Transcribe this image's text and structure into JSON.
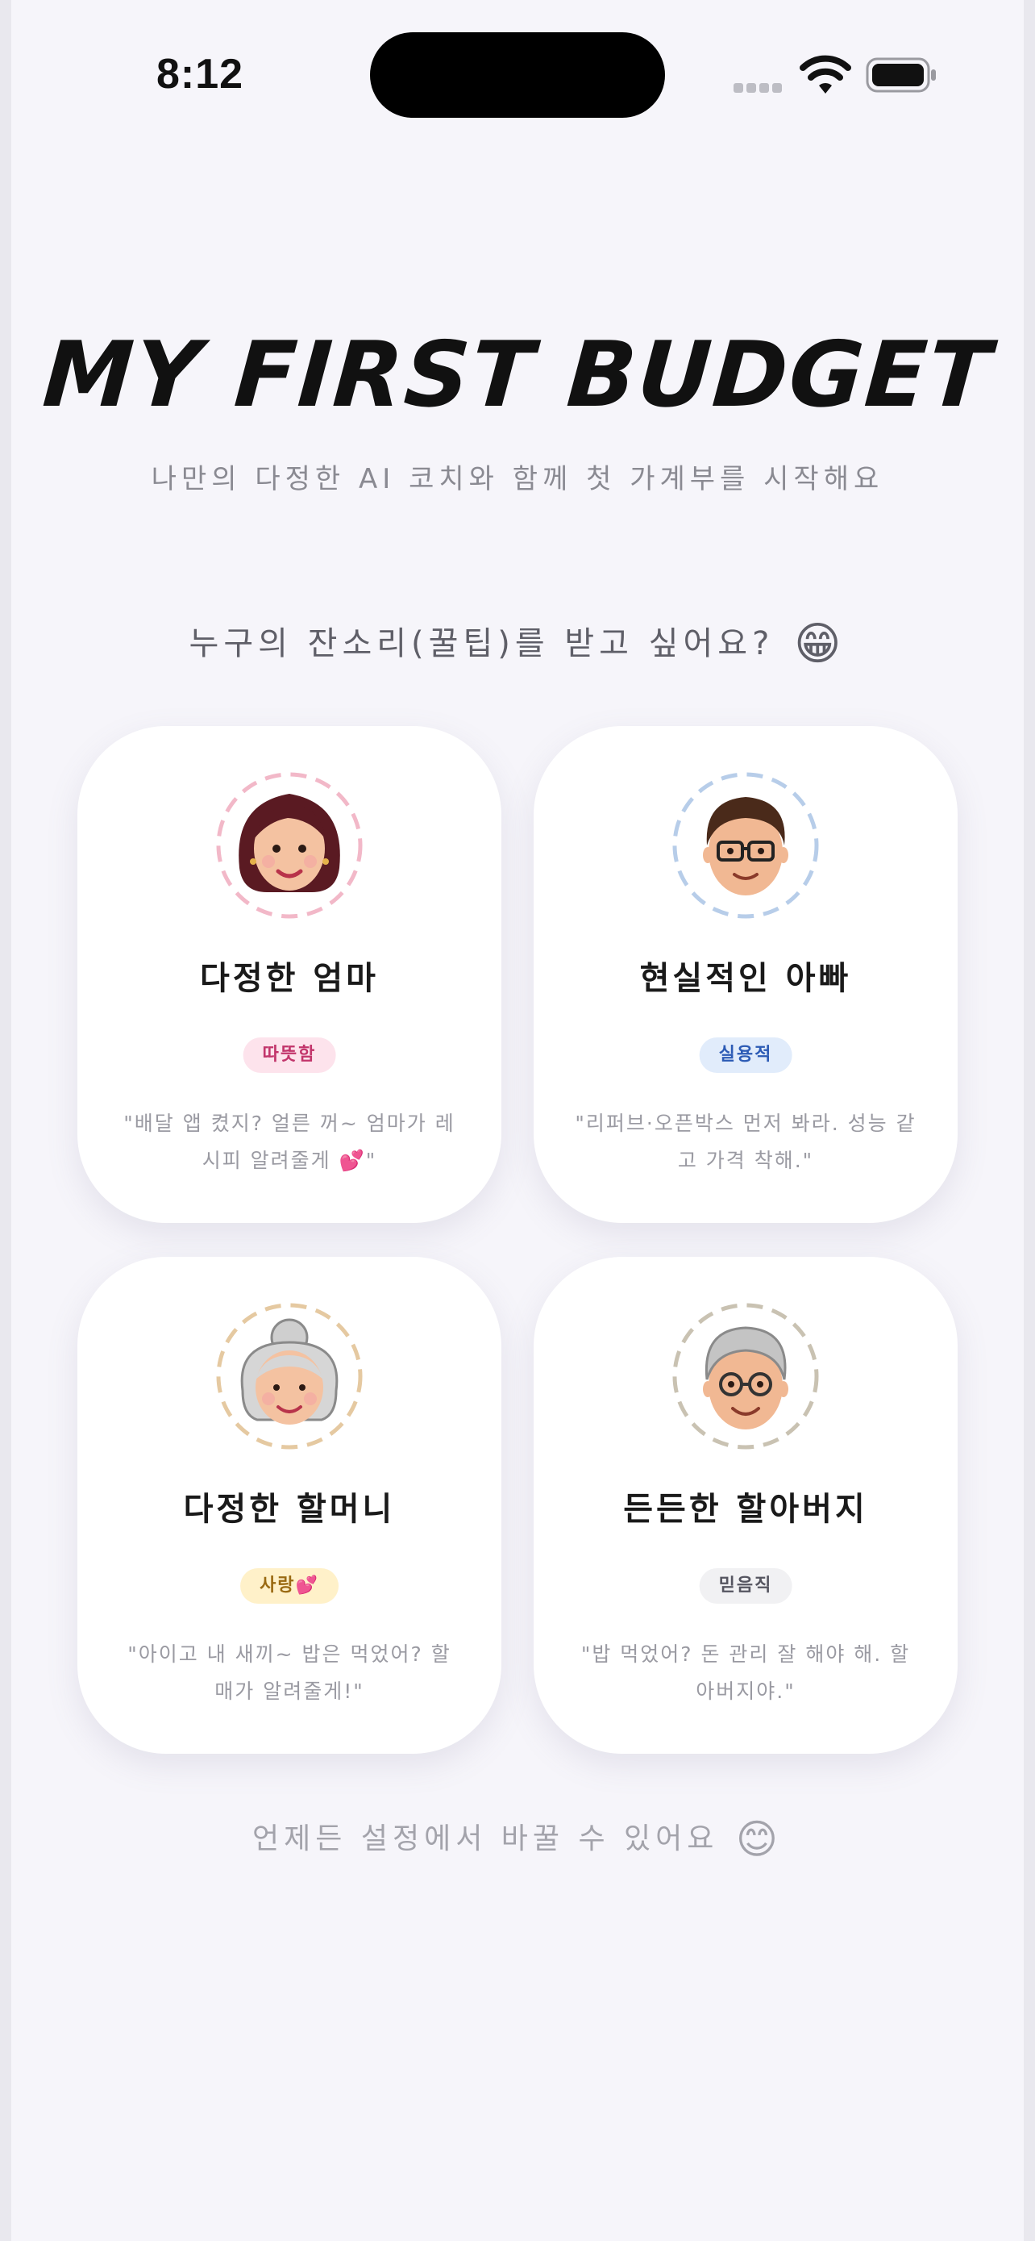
{
  "status_bar": {
    "time": "8:12"
  },
  "header": {
    "title": "MY FIRST BUDGET",
    "subtitle": "나만의 다정한 AI 코치와 함께 첫 가계부를 시작해요"
  },
  "question": {
    "text": "누구의 잔소리(꿀팁)를 받고 싶어요?",
    "emoji": "😁"
  },
  "cards": [
    {
      "name": "다정한 엄마",
      "tag": "따뜻함",
      "quote": "\"배달 앱 켰지? 얼른 꺼~ 엄마가 레시피 알려줄게 💕\"",
      "colors": {
        "ring": "#f2b8c8",
        "tag_bg": "#fde3ec",
        "tag_fg": "#c2356b"
      }
    },
    {
      "name": "현실적인 아빠",
      "tag": "실용적",
      "quote": "\"리퍼브·오픈박스 먼저 봐라. 성능 같고 가격 착해.\"",
      "colors": {
        "ring": "#b7cde9",
        "tag_bg": "#e1ecfb",
        "tag_fg": "#2c5bb5"
      }
    },
    {
      "name": "다정한 할머니",
      "tag": "사랑💕",
      "quote": "\"아이고 내 새끼~ 밥은 먹었어? 할매가 알려줄게!\"",
      "colors": {
        "ring": "#e5c9a1",
        "tag_bg": "#fff1c9",
        "tag_fg": "#9a6a12"
      }
    },
    {
      "name": "든든한 할아버지",
      "tag": "믿음직",
      "quote": "\"밥 먹었어? 돈 관리 잘 해야 해. 할아버지야.\"",
      "colors": {
        "ring": "#c9c2b2",
        "tag_bg": "#f1f1f3",
        "tag_fg": "#555560"
      }
    }
  ],
  "footer": {
    "text": "언제든 설정에서 바꿀 수 있어요",
    "emoji": "😊"
  }
}
